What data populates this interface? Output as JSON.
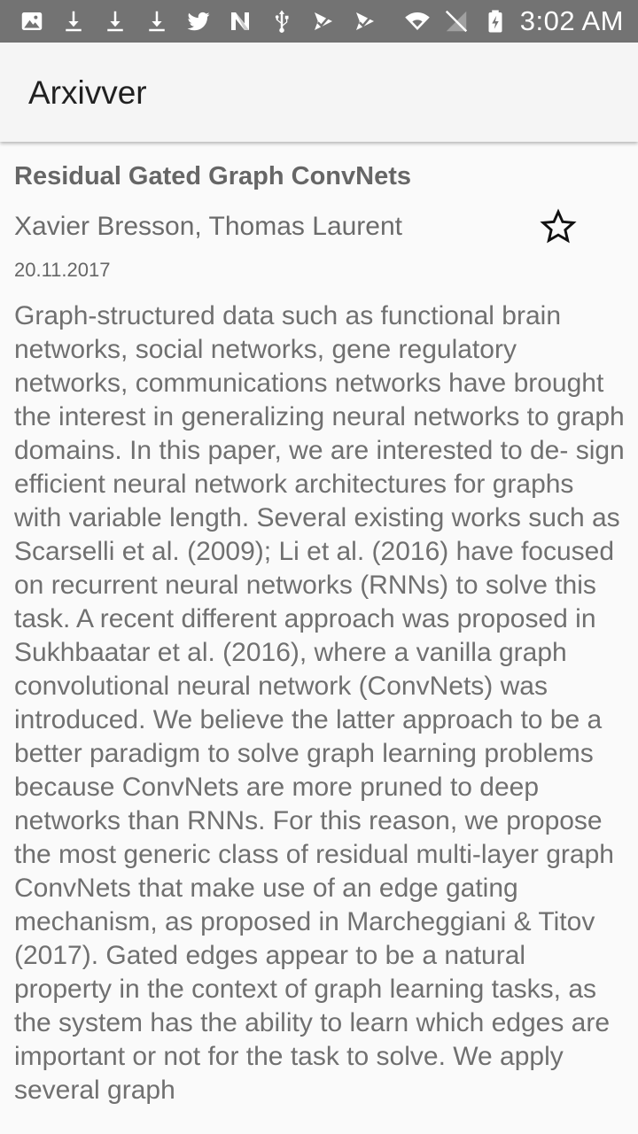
{
  "status_bar": {
    "time": "3:02 AM",
    "left_icons": [
      "image-icon",
      "download-icon",
      "download-icon",
      "download-icon",
      "twitter-icon",
      "n-icon",
      "usb-icon",
      "check-icon",
      "check-icon"
    ],
    "right_icons": [
      "wifi-icon",
      "no-signal-icon",
      "battery-charging-icon"
    ]
  },
  "app_bar": {
    "title": "Arxivver"
  },
  "paper": {
    "title": "Residual Gated Graph ConvNets",
    "authors": "Xavier Bresson, Thomas Laurent",
    "date": "20.11.2017",
    "starred": false,
    "abstract": "Graph-structured data such as functional brain networks, social networks, gene regulatory networks, communications networks have brought the interest in generalizing neural networks to graph domains. In this paper, we are interested to de- sign efficient neural network architectures for graphs with variable length. Several existing works such as Scarselli et al. (2009); Li et al. (2016) have focused on recurrent neural networks (RNNs) to solve this task. A recent different approach was proposed in Sukhbaatar et al. (2016), where a vanilla graph convolutional neural network (ConvNets) was introduced. We believe the latter approach to be a better paradigm to solve graph learning problems because ConvNets are more pruned to deep networks than RNNs. For this reason, we propose the most generic class of residual multi-layer graph ConvNets that make use of an edge gating mechanism, as proposed in Marcheggiani & Titov (2017). Gated edges appear to be a natural property in the context of graph learning tasks, as the system has the ability to learn which edges are important or not for the task to solve. We apply several graph"
  },
  "colors": {
    "status_bar": "#737373",
    "app_bar": "#f5f5f5",
    "background": "#fafafa",
    "text": "#707070"
  }
}
